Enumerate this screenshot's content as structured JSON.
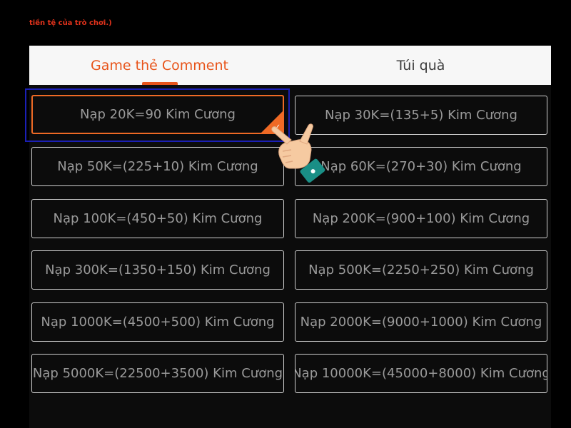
{
  "note_text": "tiền tệ của trò chơi.)",
  "tabs": [
    {
      "label": "Game thẻ Comment",
      "active": true
    },
    {
      "label": "Túi quà",
      "active": false
    }
  ],
  "options": [
    {
      "label": "Nạp 20K=90 Kim Cương",
      "selected": true
    },
    {
      "label": "Nạp 30K=(135+5) Kim Cương",
      "selected": false
    },
    {
      "label": "Nạp 50K=(225+10) Kim Cương",
      "selected": false
    },
    {
      "label": "Nạp 60K=(270+30) Kim Cương",
      "selected": false
    },
    {
      "label": "Nạp 100K=(450+50) Kim Cương",
      "selected": false
    },
    {
      "label": "Nạp 200K=(900+100) Kim Cương",
      "selected": false
    },
    {
      "label": "Nạp 300K=(1350+150) Kim Cương",
      "selected": false
    },
    {
      "label": "Nạp 500K=(2250+250) Kim Cương",
      "selected": false
    },
    {
      "label": "Nạp 1000K=(4500+500) Kim Cương",
      "selected": false
    },
    {
      "label": "Nạp 2000K=(9000+1000) Kim Cương",
      "selected": false
    },
    {
      "label": "Nạp 5000K=(22500+3500) Kim Cương",
      "selected": false
    },
    {
      "label": "Nạp 10000K=(45000+8000) Kim Cương",
      "selected": false
    }
  ],
  "icons": {
    "selected_check": "check-icon",
    "pointer": "pointing-hand-icon"
  },
  "colors": {
    "accent": "#ef6a25",
    "tab_active": "#e8541a",
    "note": "#e5331c",
    "highlight_frame": "#1b1fb5",
    "background": "#000000"
  }
}
